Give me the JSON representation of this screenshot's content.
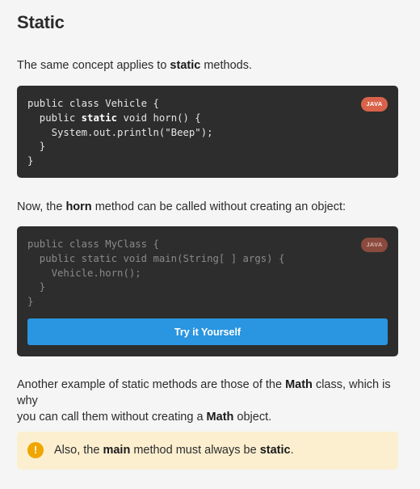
{
  "section": {
    "title": "Static"
  },
  "intro": {
    "before": "The same concept applies to ",
    "bold": "static",
    "after": " methods."
  },
  "code1": {
    "language": "JAVA",
    "lines": [
      "public class Vehicle {",
      "  public static void horn() {",
      "    System.out.println(\"Beep\");",
      "  }",
      "}"
    ]
  },
  "para2": {
    "before": "Now, the ",
    "bold": "horn",
    "after": " method can be called without creating an object:"
  },
  "code2": {
    "language": "JAVA",
    "lines": [
      "public class MyClass {",
      "  public static void main(String[ ] args) {",
      "    Vehicle.horn();",
      "  }",
      "}"
    ],
    "button_label": "Try it Yourself"
  },
  "para3": {
    "p1": "Another example of static methods are those of the ",
    "b1": "Math",
    "p2": " class, which is why",
    "p3": "you can call them without creating a ",
    "b2": "Math",
    "p4": " object."
  },
  "note": {
    "icon": "!",
    "before": "Also, the ",
    "b1": "main",
    "middle": " method must always be ",
    "b2": "static",
    "after": "."
  },
  "colors": {
    "background": "#f5f5f5",
    "code_bg": "#2d2d2d",
    "badge": "#d9634a",
    "button": "#2a95e0",
    "note_bg": "#fcefd0",
    "warn_icon": "#f0a500"
  }
}
